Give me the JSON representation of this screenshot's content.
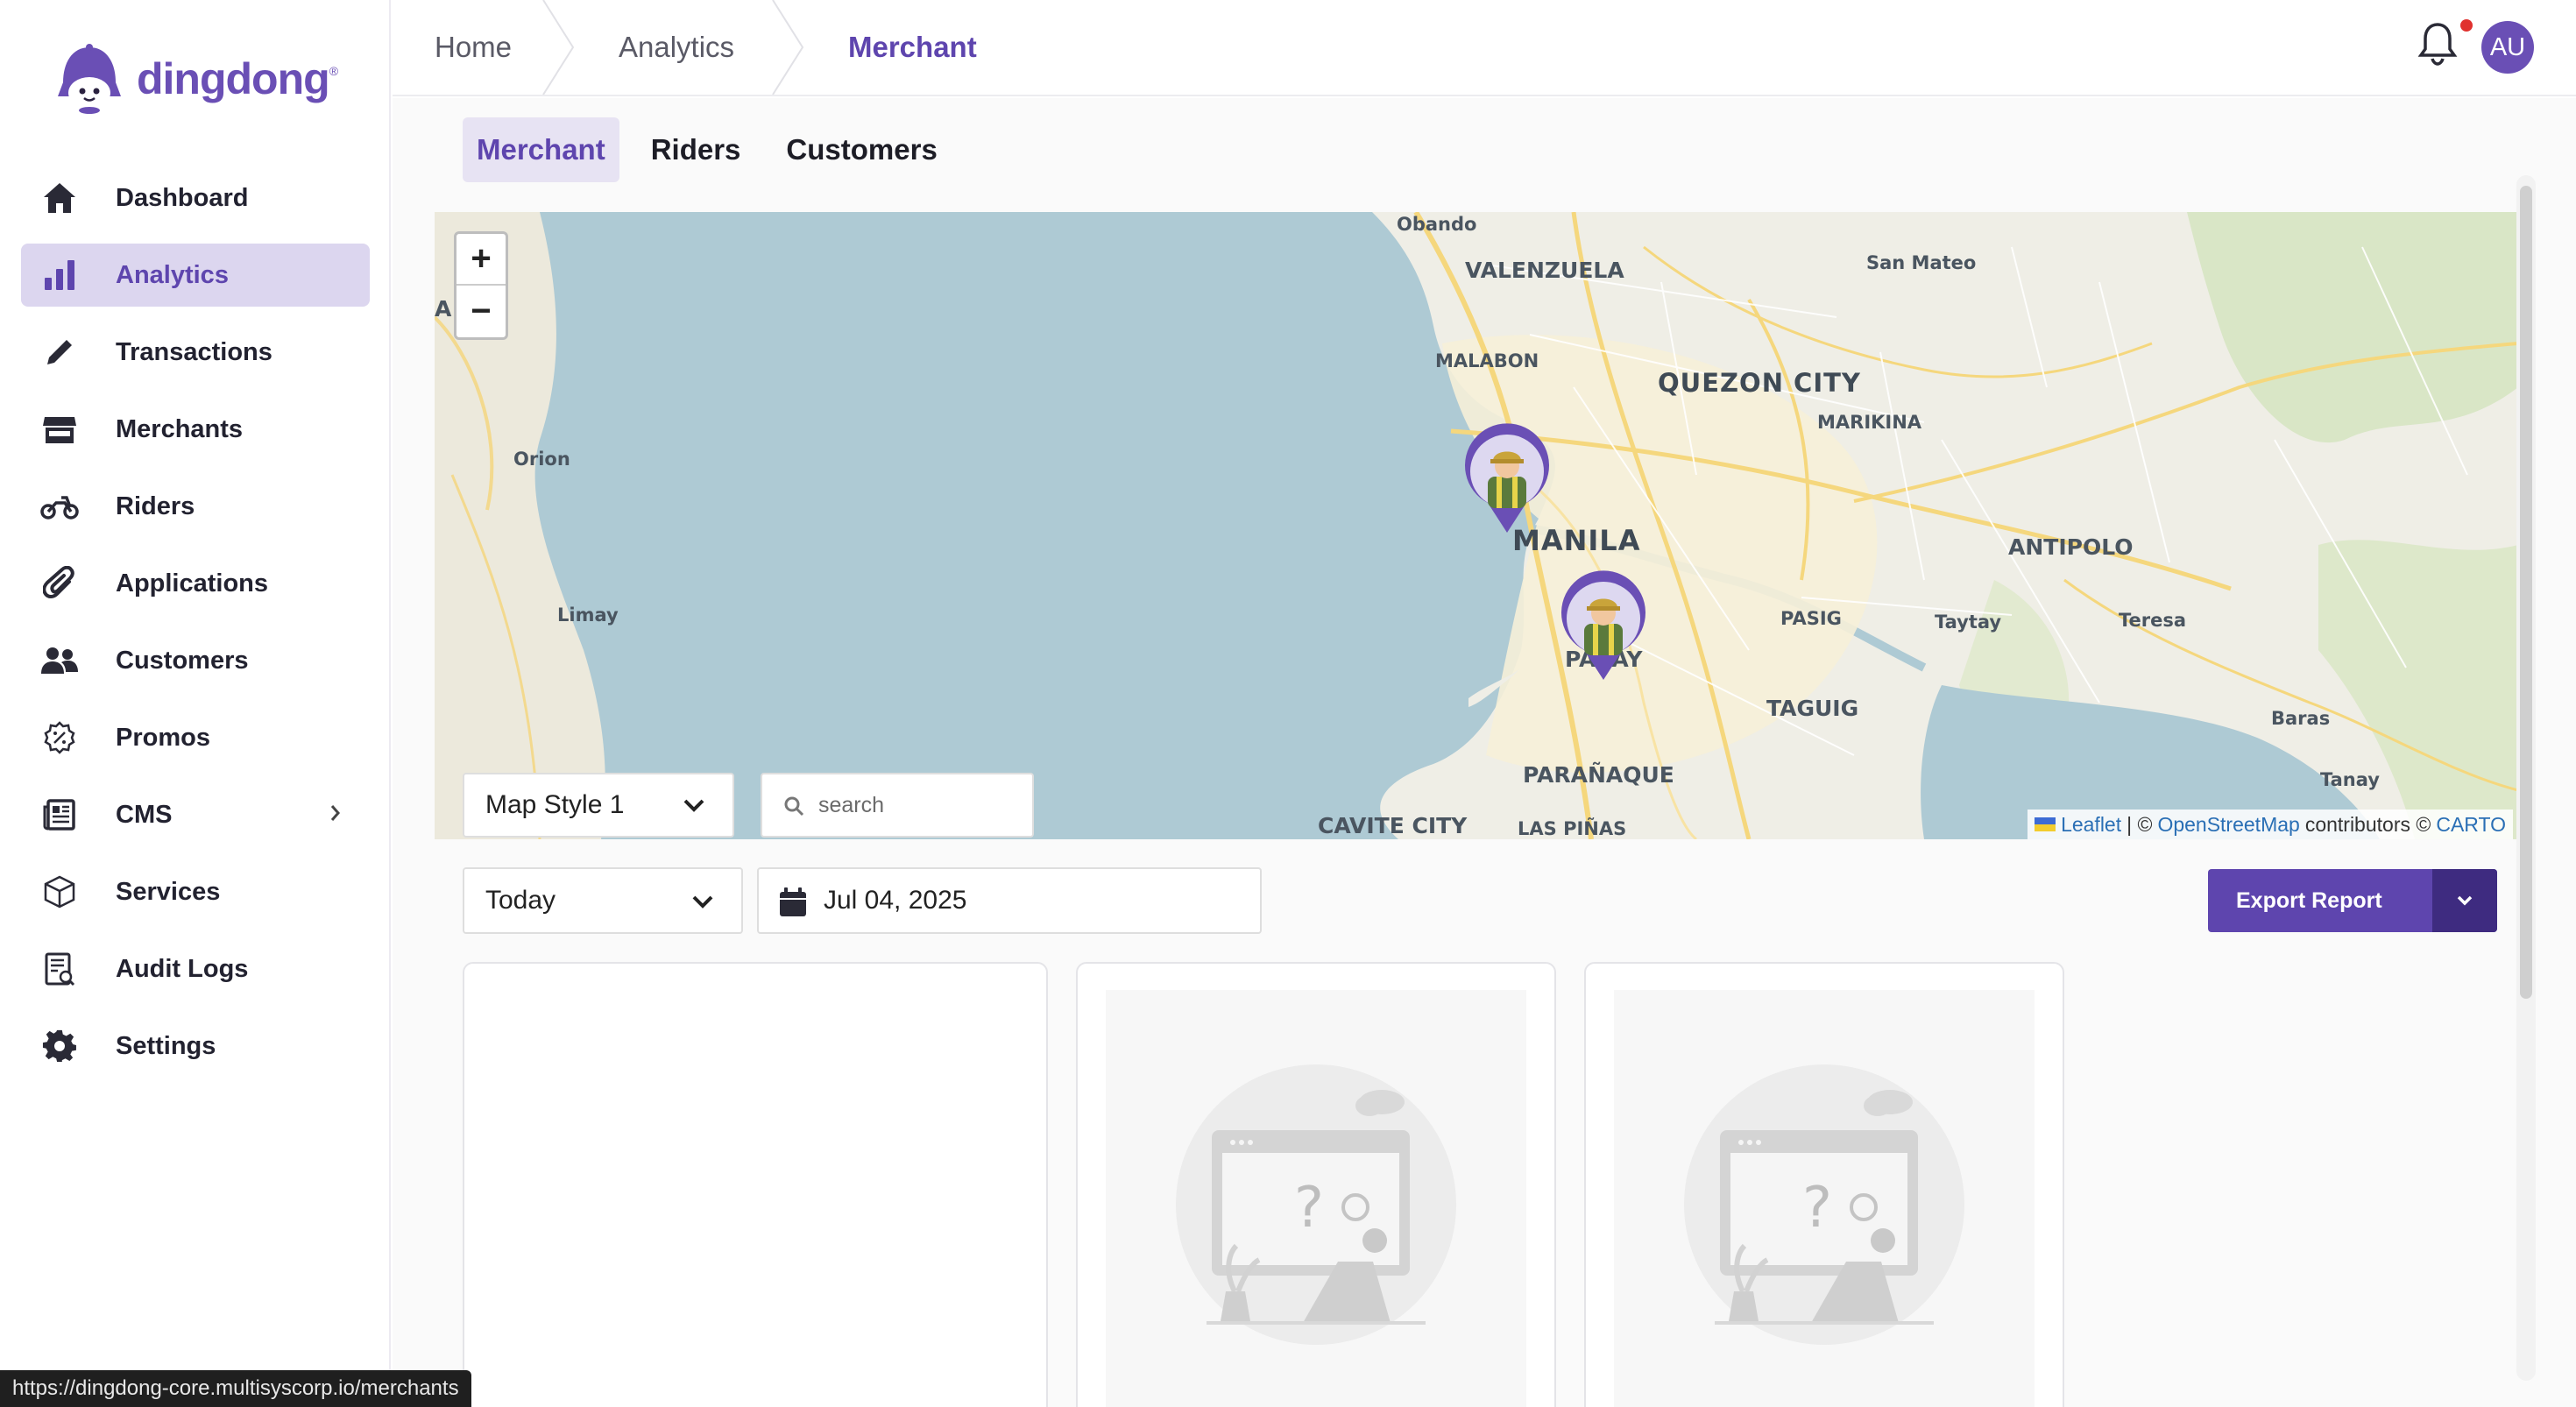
{
  "brand": {
    "name": "dingdong",
    "trademark": "®",
    "color": "#6a4fb5"
  },
  "sidebar": {
    "items": [
      {
        "label": "Dashboard",
        "icon": "home-icon"
      },
      {
        "label": "Analytics",
        "icon": "bar-chart-icon",
        "active": true
      },
      {
        "label": "Transactions",
        "icon": "pencil-icon"
      },
      {
        "label": "Merchants",
        "icon": "store-icon"
      },
      {
        "label": "Riders",
        "icon": "motorcycle-icon"
      },
      {
        "label": "Applications",
        "icon": "paperclip-icon"
      },
      {
        "label": "Customers",
        "icon": "users-icon"
      },
      {
        "label": "Promos",
        "icon": "badge-icon"
      },
      {
        "label": "CMS",
        "icon": "newspaper-icon",
        "has_children": true
      },
      {
        "label": "Services",
        "icon": "cube-icon"
      },
      {
        "label": "Audit Logs",
        "icon": "report-icon"
      },
      {
        "label": "Settings",
        "icon": "gear-icon"
      }
    ]
  },
  "breadcrumb": [
    "Home",
    "Analytics",
    "Merchant"
  ],
  "header": {
    "avatar_initials": "AU",
    "notification_dot": "#e0312e"
  },
  "tabs": [
    {
      "label": "Merchant",
      "active": true
    },
    {
      "label": "Riders"
    },
    {
      "label": "Customers"
    }
  ],
  "map": {
    "zoom_in": "+",
    "zoom_out": "−",
    "style_select": "Map Style 1",
    "search_placeholder": "search",
    "labels": {
      "obando": "Obando",
      "valenzuela": "VALENZUELA",
      "san_mateo": "San Mateo",
      "malabon": "MALABON",
      "quezon_city": "QUEZON CITY",
      "marikina": "MARIKINA",
      "orion": "Orion",
      "manila": "MANILA",
      "antipolo": "ANTIPOLO",
      "limay": "Limay",
      "pasig": "PASIG",
      "taytay": "Taytay",
      "teresa": "Teresa",
      "pasay": "PASAY",
      "taguig": "TAGUIG",
      "baras": "Baras",
      "paranaque": "PARAÑAQUE",
      "tanay": "Tanay",
      "cavite_city": "CAVITE CITY",
      "las_pinas": "LAS PIÑAS",
      "edge_a": "A"
    },
    "attribution": {
      "leaflet": "Leaflet",
      "sep": "| ©",
      "osm": "OpenStreetMap",
      "contributors": "contributors ©",
      "carto": "CARTO"
    }
  },
  "filters": {
    "period": "Today",
    "date": "Jul 04, 2025",
    "export_label": "Export Report"
  },
  "status_url": "https://dingdong-core.multisyscorp.io/merchants"
}
